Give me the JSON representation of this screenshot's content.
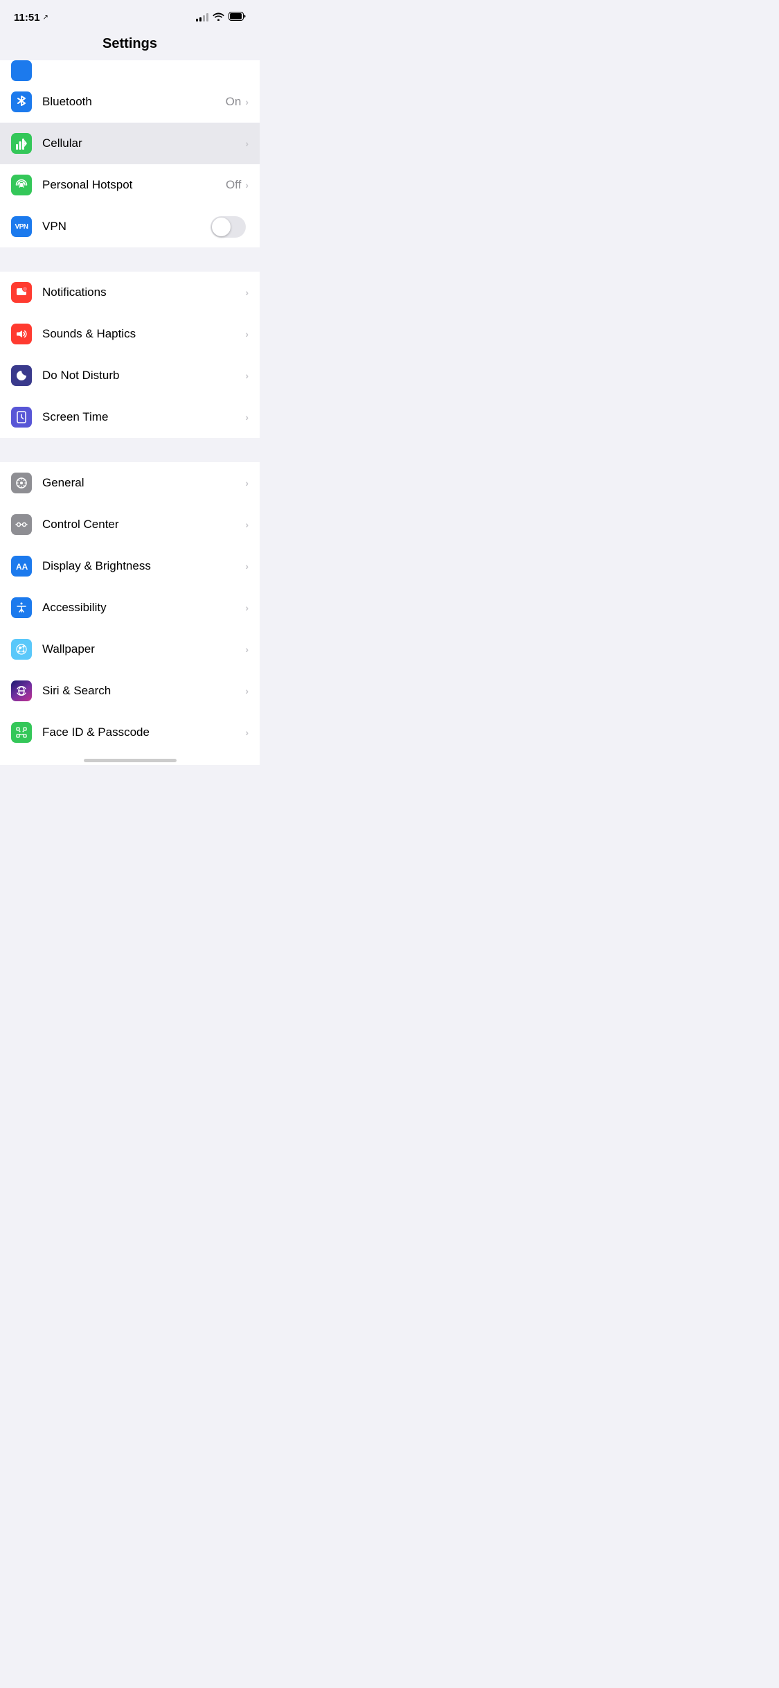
{
  "statusBar": {
    "time": "11:51",
    "locationArrow": "↗"
  },
  "header": {
    "title": "Settings"
  },
  "sections": [
    {
      "id": "connectivity",
      "rows": [
        {
          "id": "wifi-partial",
          "partial": true,
          "iconBg": "bg-blue",
          "iconSymbol": "wifi"
        },
        {
          "id": "bluetooth",
          "label": "Bluetooth",
          "value": "On",
          "hasChevron": true,
          "iconBg": "bg-blue",
          "iconSymbol": "bluetooth"
        },
        {
          "id": "cellular",
          "label": "Cellular",
          "value": "",
          "hasChevron": true,
          "highlighted": true,
          "iconBg": "bg-green",
          "iconSymbol": "cellular"
        },
        {
          "id": "personal-hotspot",
          "label": "Personal Hotspot",
          "value": "Off",
          "hasChevron": true,
          "iconBg": "bg-green",
          "iconSymbol": "hotspot"
        },
        {
          "id": "vpn",
          "label": "VPN",
          "hasToggle": true,
          "toggleOn": false,
          "iconBg": "bg-blue",
          "iconSymbol": "vpn"
        }
      ]
    },
    {
      "id": "notifications",
      "rows": [
        {
          "id": "notifications",
          "label": "Notifications",
          "hasChevron": true,
          "iconBg": "bg-red",
          "iconSymbol": "notifications"
        },
        {
          "id": "sounds-haptics",
          "label": "Sounds & Haptics",
          "hasChevron": true,
          "iconBg": "bg-red",
          "iconSymbol": "sounds"
        },
        {
          "id": "do-not-disturb",
          "label": "Do Not Disturb",
          "hasChevron": true,
          "iconBg": "bg-indigo",
          "iconSymbol": "moon"
        },
        {
          "id": "screen-time",
          "label": "Screen Time",
          "hasChevron": true,
          "iconBg": "bg-purple",
          "iconSymbol": "screentime"
        }
      ]
    },
    {
      "id": "display",
      "rows": [
        {
          "id": "general",
          "label": "General",
          "hasChevron": true,
          "iconBg": "bg-gray",
          "iconSymbol": "gear"
        },
        {
          "id": "control-center",
          "label": "Control Center",
          "hasChevron": true,
          "iconBg": "bg-gray",
          "iconSymbol": "sliders"
        },
        {
          "id": "display-brightness",
          "label": "Display & Brightness",
          "hasChevron": true,
          "iconBg": "bg-blue-aa",
          "iconSymbol": "aa"
        },
        {
          "id": "accessibility",
          "label": "Accessibility",
          "hasChevron": true,
          "iconBg": "bg-blue-access",
          "iconSymbol": "accessibility"
        },
        {
          "id": "wallpaper",
          "label": "Wallpaper",
          "hasChevron": true,
          "iconBg": "bg-blue-wallpaper",
          "iconSymbol": "wallpaper"
        },
        {
          "id": "siri-search",
          "label": "Siri & Search",
          "hasChevron": true,
          "iconBg": "bg-gradient-siri",
          "iconSymbol": "siri"
        },
        {
          "id": "face-id",
          "label": "Face ID & Passcode",
          "hasChevron": true,
          "partial": false,
          "partialBottom": true,
          "iconBg": "bg-green-faceid",
          "iconSymbol": "faceid"
        }
      ]
    }
  ]
}
